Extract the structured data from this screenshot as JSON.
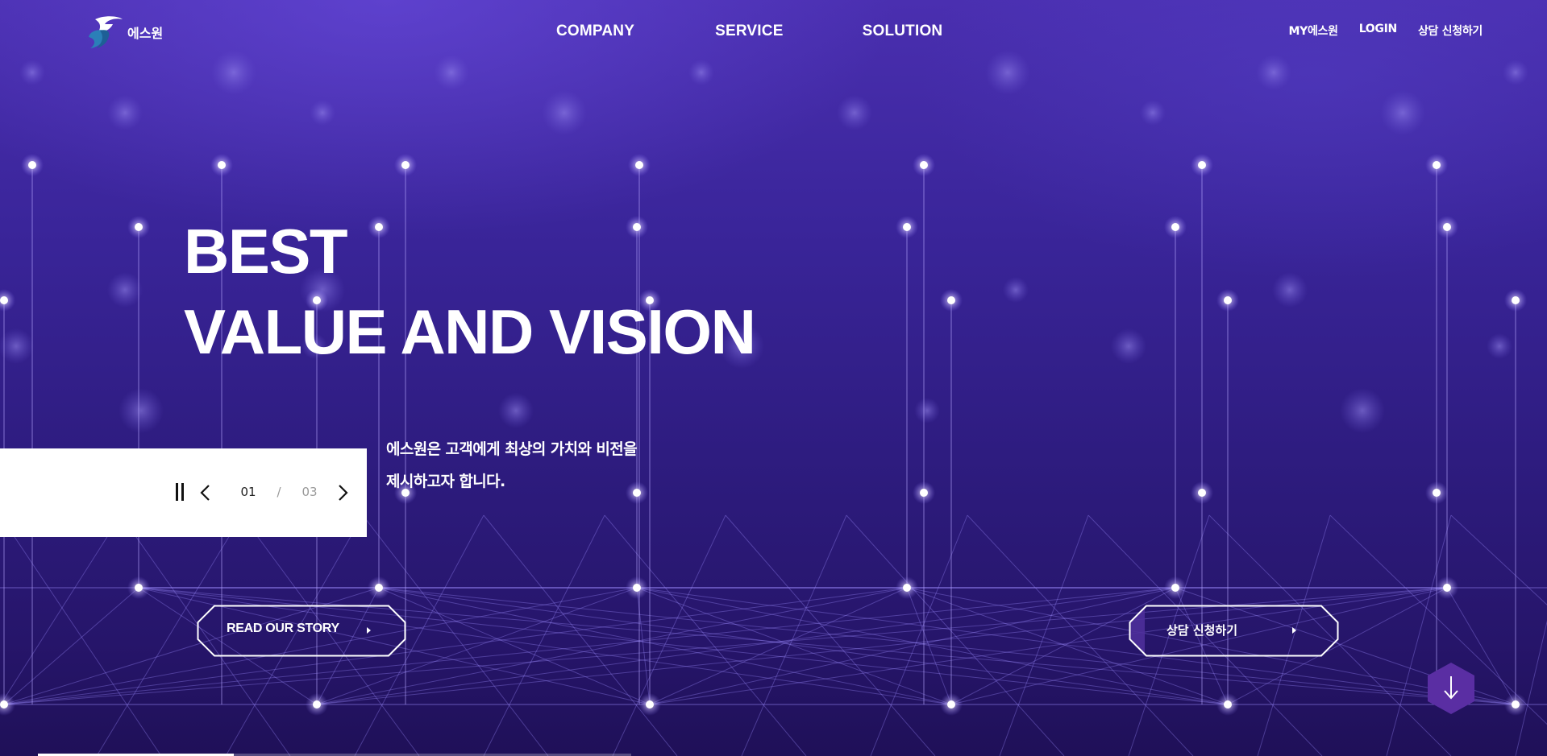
{
  "header": {
    "logo_text": "에스원",
    "main_nav": [
      "COMPANY",
      "SERVICE",
      "SOLUTION"
    ],
    "util_nav": [
      "MY에스원",
      "LOGIN",
      "상담 신청하기"
    ]
  },
  "hero": {
    "headline_line1": "BEST",
    "headline_line2": "VALUE AND VISION",
    "subtext_line1": "에스원은 고객에게 최상의 가치와 비전을",
    "subtext_line2": "제시하고자 합니다."
  },
  "slider": {
    "current": "01",
    "separator": "/",
    "total": "03",
    "progress": 0.33
  },
  "buttons": {
    "story_label": "READ OUR STORY",
    "consult_label": "상담 신청하기"
  },
  "colors": {
    "accent": "#4a2a9a",
    "background_top": "#4a2fb0",
    "background_bottom": "#1f1058"
  },
  "icons": {
    "pause": "pause-icon",
    "prev": "chevron-left-icon",
    "next": "chevron-right-icon",
    "scroll": "arrow-down-icon"
  }
}
